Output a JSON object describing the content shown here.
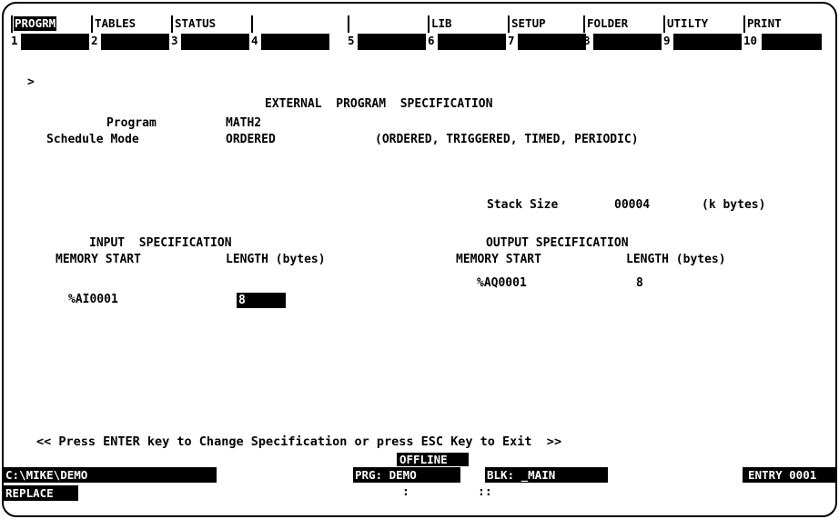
{
  "function_keys": [
    {
      "num": "1",
      "label": "PROGRM",
      "active": true
    },
    {
      "num": "2",
      "label": "TABLES",
      "active": false
    },
    {
      "num": "3",
      "label": "STATUS",
      "active": false
    },
    {
      "num": "4",
      "label": "",
      "active": false
    },
    {
      "num": "5",
      "label": "",
      "active": false
    },
    {
      "num": "6",
      "label": "LIB",
      "active": false
    },
    {
      "num": "7",
      "label": "SETUP",
      "active": false
    },
    {
      "num": "8",
      "label": "FOLDER",
      "active": false
    },
    {
      "num": "9",
      "label": "UTILTY",
      "active": false
    },
    {
      "num": "10",
      "label": "PRINT",
      "active": false
    }
  ],
  "prompt": ">",
  "title": "EXTERNAL  PROGRAM  SPECIFICATION",
  "program": {
    "label": "Program",
    "value": "MATH2"
  },
  "schedule": {
    "label": "Schedule Mode",
    "value": "ORDERED",
    "options": "(ORDERED, TRIGGERED, TIMED, PERIODIC)"
  },
  "stack": {
    "label": "Stack Size",
    "value": "00004",
    "unit": "(k bytes)"
  },
  "input_spec": {
    "heading": "INPUT  SPECIFICATION",
    "col_start": "MEMORY START",
    "col_length": "LENGTH (bytes)",
    "start": "%AI0001",
    "length": "8"
  },
  "output_spec": {
    "heading": "OUTPUT SPECIFICATION",
    "col_start": "MEMORY START",
    "col_length": "LENGTH (bytes)",
    "start": "%AQ0001",
    "length": "8"
  },
  "instruction": "<< Press ENTER key to Change Specification or press ESC Key to Exit  >>",
  "status": {
    "path": "C:\\MIKE\\DEMO",
    "mode": "OFFLINE",
    "program": "PRG: DEMO",
    "block": "BLK: _MAIN",
    "entry": "ENTRY 0001",
    "edit_mode": "REPLACE",
    "sep1": ":",
    "sep2": "::"
  }
}
